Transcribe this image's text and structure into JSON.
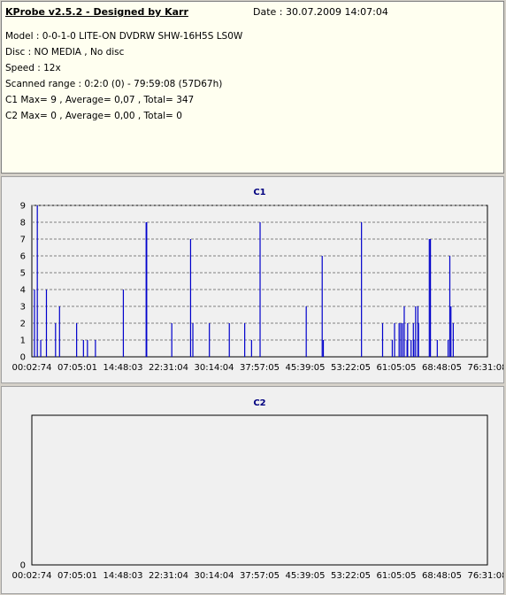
{
  "header": {
    "title": "KProbe v2.5.2 - Designed by Karr",
    "date": "Date : 30.07.2009 14:07:04"
  },
  "info": {
    "model": "Model : 0-0-1-0 LITE-ON DVDRW SHW-16H5S  LS0W",
    "disc": "Disc : NO MEDIA , No disc",
    "speed": "Speed : 12x",
    "scanned_range": "Scanned range : 0:2:0 (0) - 79:59:08 (57D67h)",
    "c1_summary": "C1 Max= 9 , Average= 0,07 , Total= 347",
    "c2_summary": "C2 Max= 0 , Average= 0,00 , Total= 0"
  },
  "colors": {
    "series": "#0000cc",
    "title": "#000080",
    "grid": "#808080"
  },
  "chart_data": [
    {
      "type": "bar",
      "title": "C1",
      "xlabel": "",
      "ylabel": "",
      "x_tick_labels": [
        "00:02:74",
        "07:05:01",
        "14:48:03",
        "22:31:04",
        "30:14:04",
        "37:57:05",
        "45:39:05",
        "53:22:05",
        "61:05:05",
        "68:48:05",
        "76:31:08"
      ],
      "y_ticks": [
        0,
        1,
        2,
        3,
        4,
        5,
        6,
        7,
        8,
        9
      ],
      "ylim": [
        0,
        9
      ],
      "xlim_minutes": [
        0.04,
        80
      ],
      "grid": true,
      "x_minutes": [
        0.5,
        1.0,
        1.6,
        2.6,
        4.2,
        4.9,
        7.9,
        9.1,
        9.8,
        11.2,
        16.1,
        20.1,
        20.2,
        24.6,
        27.9,
        28.3,
        31.2,
        34.7,
        37.4,
        38.6,
        40.1,
        48.2,
        51.0,
        51.2,
        57.9,
        61.6,
        63.3,
        63.7,
        64.5,
        64.8,
        65.1,
        65.4,
        65.9,
        66.0,
        66.6,
        67.0,
        67.1,
        67.4,
        67.8,
        67.9,
        69.8,
        70.0,
        71.2,
        73.1,
        73.4,
        73.6,
        74.0
      ],
      "values": [
        4,
        9,
        1,
        4,
        2,
        3,
        2,
        1,
        1,
        1,
        4,
        8,
        8,
        2,
        7,
        2,
        2,
        2,
        2,
        1,
        8,
        3,
        6,
        1,
        8,
        2,
        1,
        2,
        2,
        2,
        2,
        3,
        1,
        2,
        1,
        2,
        1,
        3,
        3,
        2,
        7,
        7,
        1,
        1,
        6,
        3,
        2
      ]
    },
    {
      "type": "bar",
      "title": "C2",
      "xlabel": "",
      "ylabel": "",
      "x_tick_labels": [
        "00:02:74",
        "07:05:01",
        "14:48:03",
        "22:31:04",
        "30:14:04",
        "37:57:05",
        "45:39:05",
        "53:22:05",
        "61:05:05",
        "68:48:05",
        "76:31:08"
      ],
      "y_ticks": [
        0
      ],
      "ylim": [
        0,
        1
      ],
      "xlim_minutes": [
        0.04,
        80
      ],
      "grid": true,
      "x_minutes": [],
      "values": []
    }
  ]
}
